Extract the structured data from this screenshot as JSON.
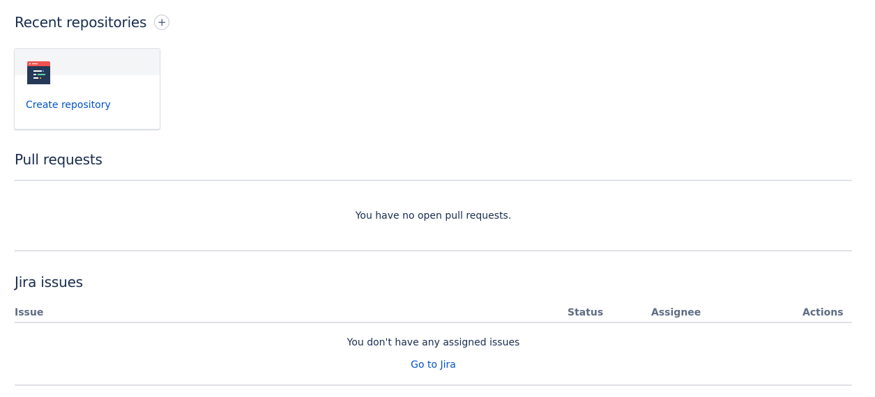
{
  "recent": {
    "title": "Recent repositories",
    "add_label": "+",
    "card": {
      "link_label": "Create repository"
    }
  },
  "pull_requests": {
    "title": "Pull requests",
    "empty_message": "You have no open pull requests."
  },
  "jira": {
    "title": "Jira issues",
    "columns": [
      "Issue",
      "Status",
      "Assignee",
      "Actions"
    ],
    "empty_message": "You don't have any assigned issues",
    "link_label": "Go to Jira"
  },
  "colors": {
    "link": "#0052cc",
    "heading": "#172b4d",
    "muted_header": "#5e6c84",
    "divider": "#dfe1e6",
    "repo_icon_accent": "#ef5350",
    "repo_icon_body": "#253858"
  }
}
